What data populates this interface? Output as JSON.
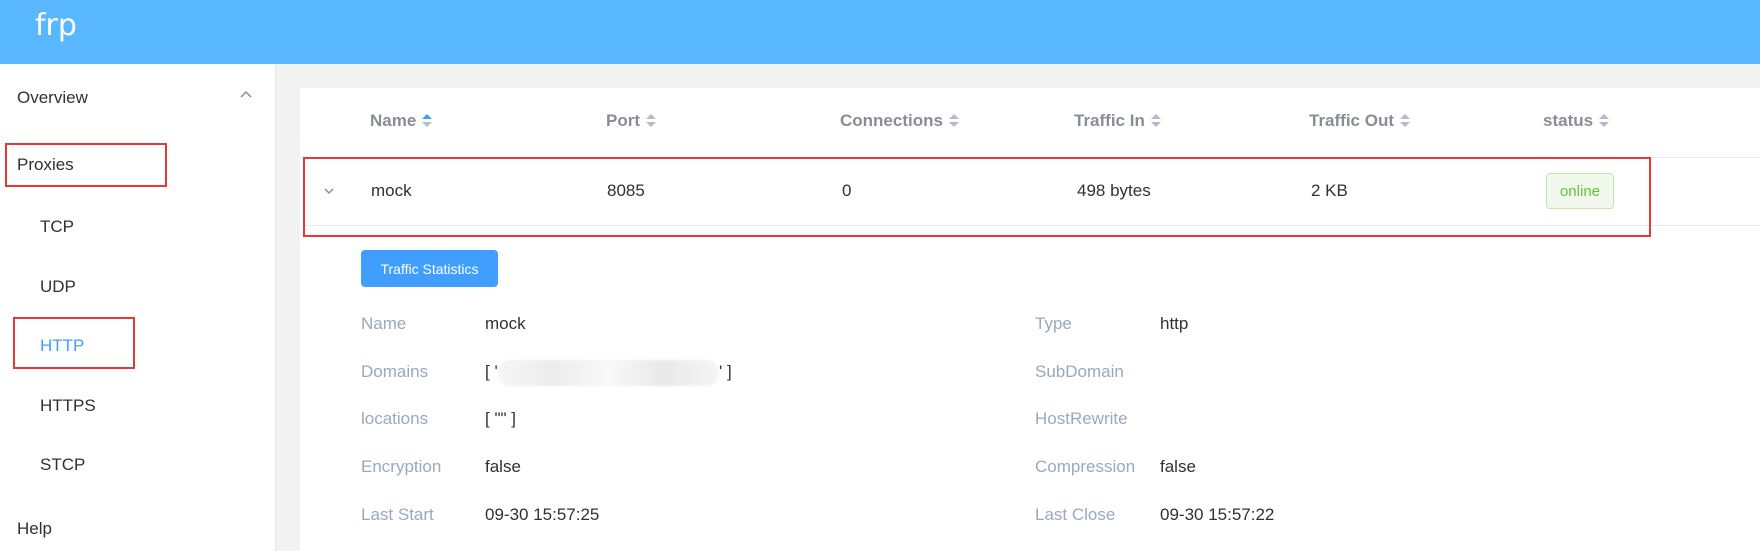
{
  "app": {
    "brand": "frp"
  },
  "sidebar": {
    "overview": "Overview",
    "proxies": "Proxies",
    "items": [
      "TCP",
      "UDP",
      "HTTP",
      "HTTPS",
      "STCP"
    ],
    "help": "Help",
    "active_item": "HTTP"
  },
  "table": {
    "columns": [
      "Name",
      "Port",
      "Connections",
      "Traffic In",
      "Traffic Out",
      "status"
    ],
    "sorted_column": "Name",
    "row": {
      "name": "mock",
      "port": "8085",
      "connections": "0",
      "traffic_in": "498 bytes",
      "traffic_out": "2 KB",
      "status": "online"
    }
  },
  "detail": {
    "button": "Traffic Statistics",
    "left": [
      {
        "label": "Name",
        "value": "mock"
      },
      {
        "label": "Domains",
        "value": "[ '",
        "value_end": "' ]"
      },
      {
        "label": "locations",
        "value": "[ \"\" ]"
      },
      {
        "label": "Encryption",
        "value": "false"
      },
      {
        "label": "Last Start",
        "value": "09-30 15:57:25"
      }
    ],
    "right": [
      {
        "label": "Type",
        "value": "http"
      },
      {
        "label": "SubDomain",
        "value": ""
      },
      {
        "label": "HostRewrite",
        "value": ""
      },
      {
        "label": "Compression",
        "value": "false"
      },
      {
        "label": "Last Close",
        "value": "09-30 15:57:22"
      }
    ]
  },
  "colors": {
    "topbar": "#58b7ff",
    "accent": "#409eff",
    "online": "#67c23a",
    "highlight": "#e53935"
  },
  "icons": {
    "submenu": "chevron-up-icon",
    "expand": "chevron-down-icon",
    "sort": "sort-caret-icon"
  }
}
